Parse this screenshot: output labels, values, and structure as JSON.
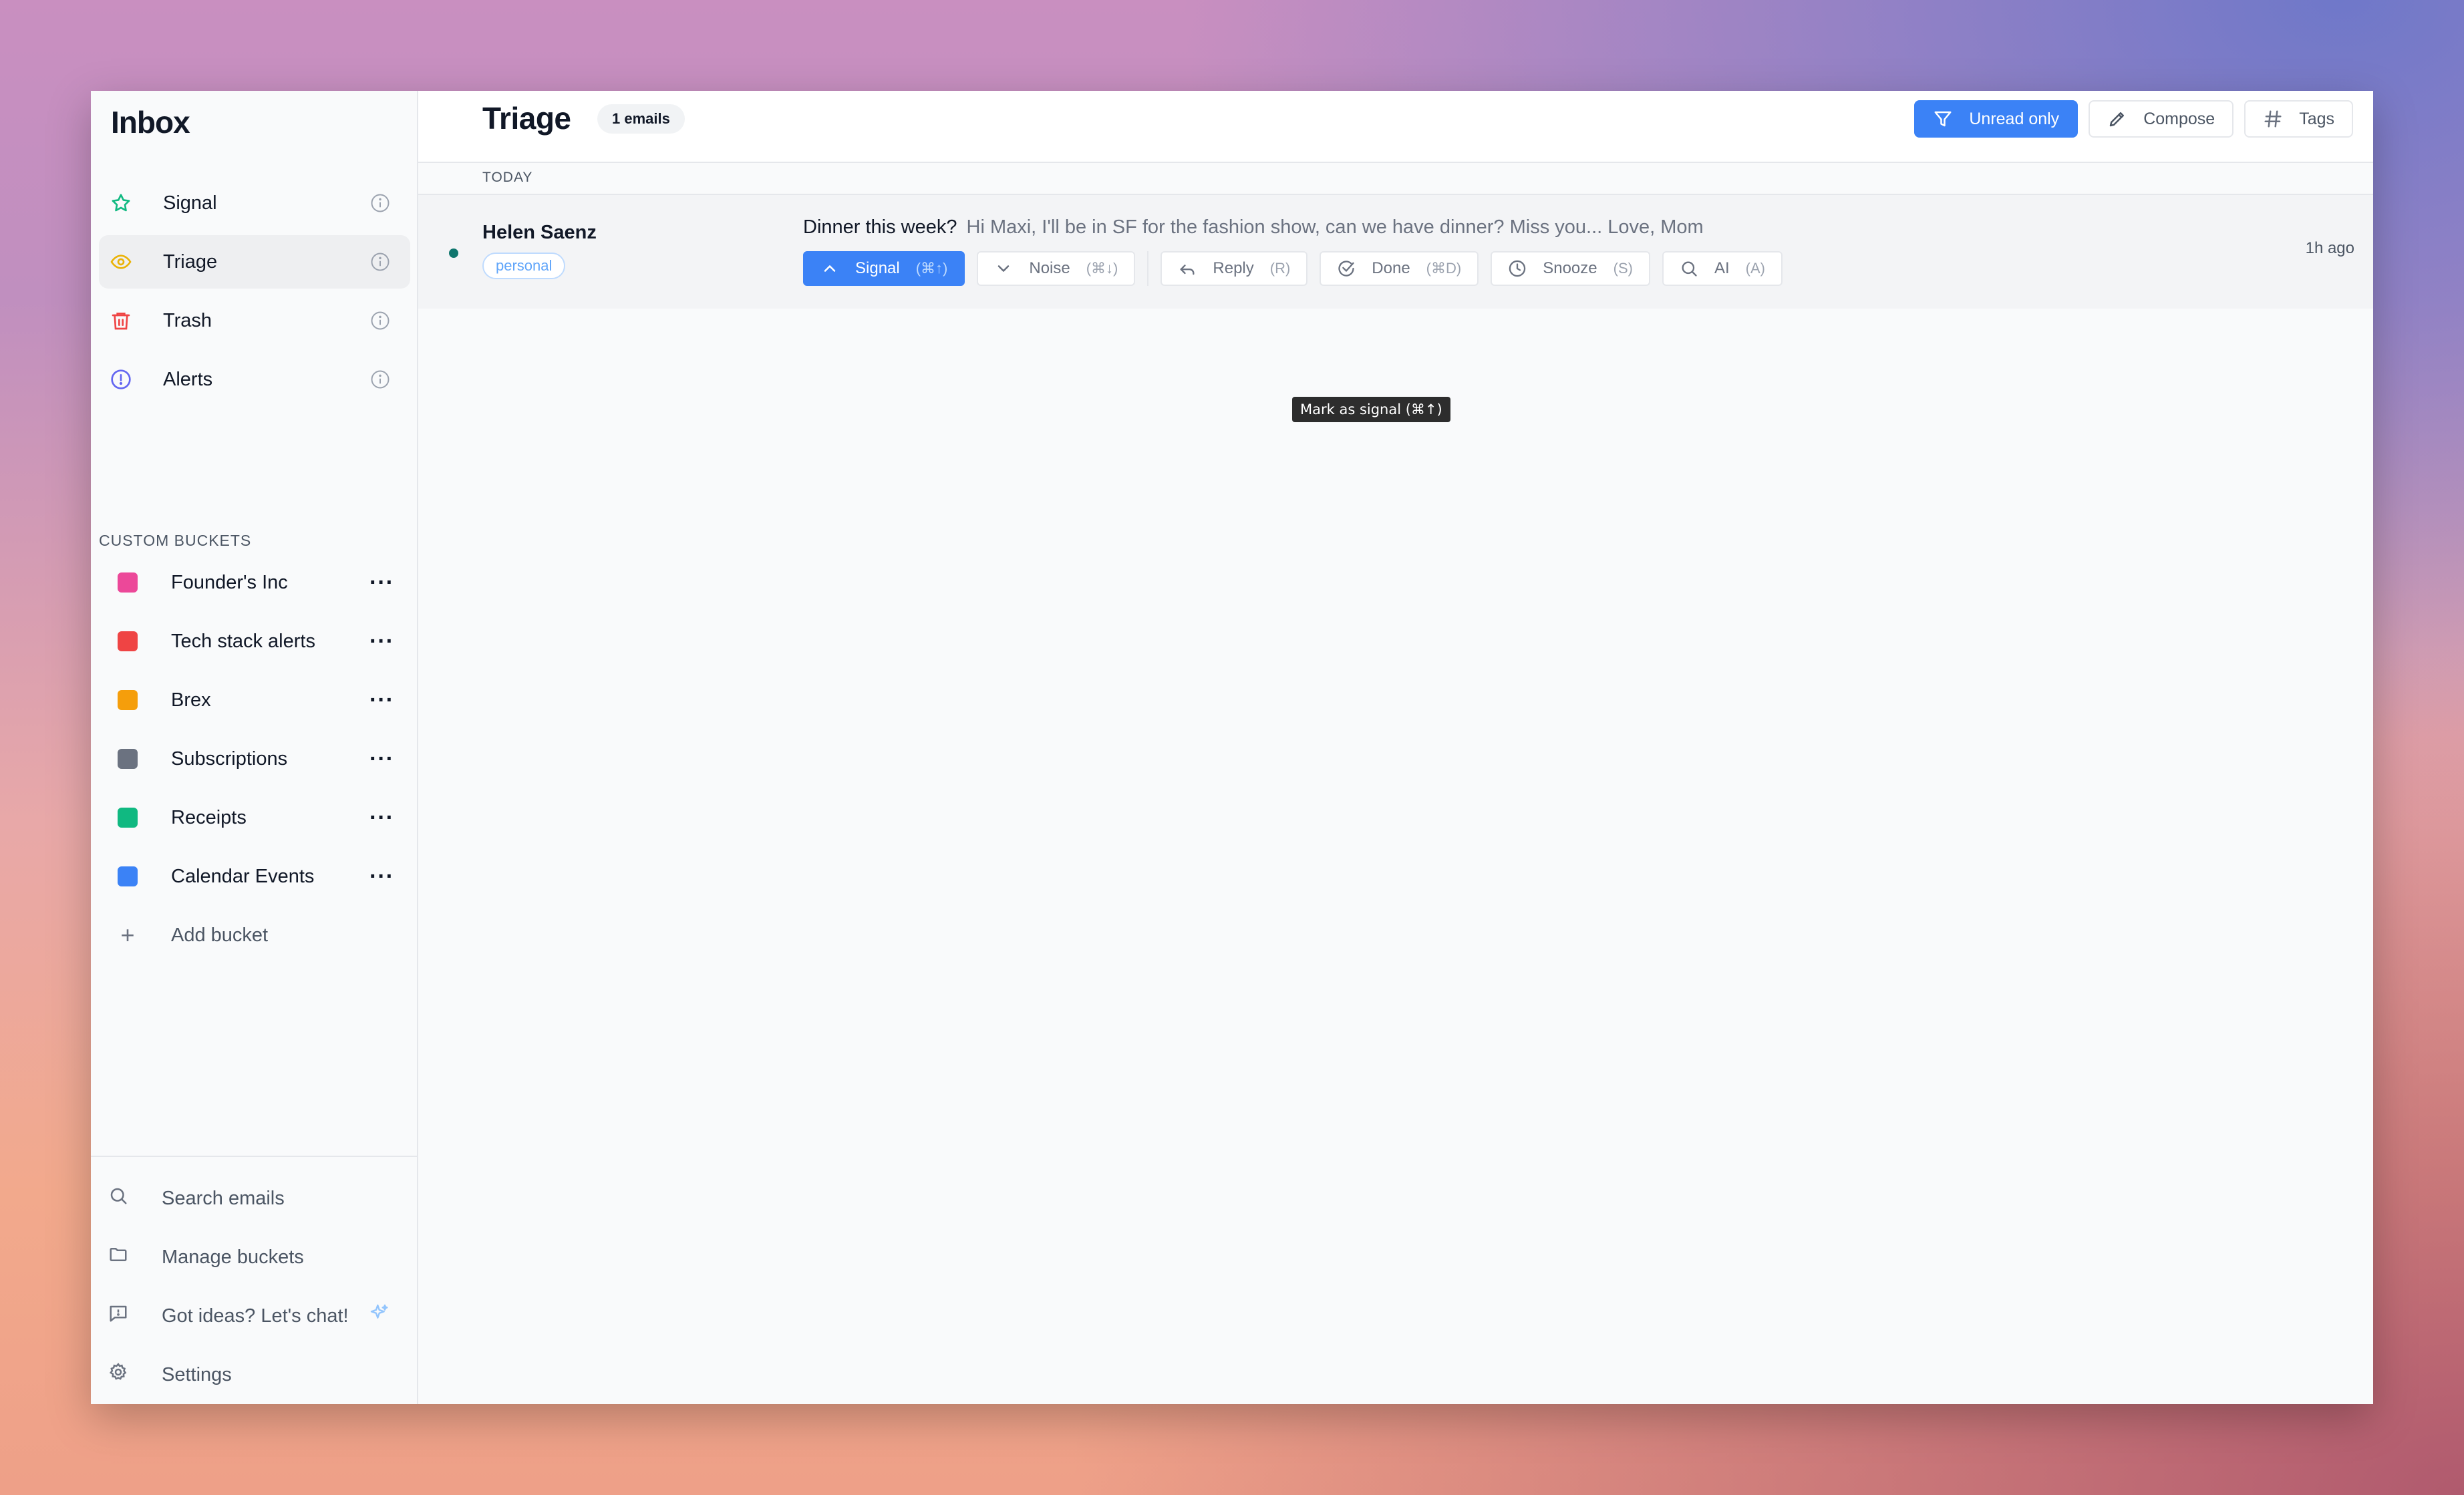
{
  "sidebar": {
    "title": "Inbox",
    "nav": [
      {
        "label": "Signal",
        "icon": "star-icon",
        "active": false
      },
      {
        "label": "Triage",
        "icon": "eye-icon",
        "active": true
      },
      {
        "label": "Trash",
        "icon": "trash-icon",
        "active": false
      },
      {
        "label": "Alerts",
        "icon": "alert-circle-icon",
        "active": false
      }
    ],
    "custom_buckets_label": "CUSTOM BUCKETS",
    "buckets": [
      {
        "label": "Founder's Inc",
        "color": "#ec4899"
      },
      {
        "label": "Tech stack alerts",
        "color": "#ef4444"
      },
      {
        "label": "Brex",
        "color": "#f59e0b"
      },
      {
        "label": "Subscriptions",
        "color": "#6b7280"
      },
      {
        "label": "Receipts",
        "color": "#10b981"
      },
      {
        "label": "Calendar Events",
        "color": "#3b82f6"
      }
    ],
    "add_bucket_label": "Add bucket",
    "footer": [
      {
        "label": "Search emails",
        "icon": "search-icon"
      },
      {
        "label": "Manage buckets",
        "icon": "folder-icon"
      },
      {
        "label": "Got ideas? Let's chat!",
        "icon": "message-icon"
      },
      {
        "label": "Settings",
        "icon": "gear-icon"
      }
    ]
  },
  "header": {
    "title": "Triage",
    "count_badge": "1 emails",
    "unread_only_label": "Unread only",
    "compose_label": "Compose",
    "tags_label": "Tags"
  },
  "list": {
    "group_label": "TODAY",
    "emails": [
      {
        "sender": "Helen Saenz",
        "tag": "personal",
        "subject": "Dinner this week?",
        "preview": "Hi Maxi, I'll be in SF for the fashion show, can we have dinner? Miss you... Love, Mom",
        "time": "1h ago",
        "unread": true
      }
    ],
    "actions": [
      {
        "label": "Signal",
        "shortcut": "(⌘↑)",
        "icon": "chevron-up-icon"
      },
      {
        "label": "Noise",
        "shortcut": "(⌘↓)",
        "icon": "chevron-down-icon"
      },
      {
        "label": "Reply",
        "shortcut": "(R)",
        "icon": "reply-icon"
      },
      {
        "label": "Done",
        "shortcut": "(⌘D)",
        "icon": "check-circle-icon"
      },
      {
        "label": "Snooze",
        "shortcut": "(S)",
        "icon": "clock-icon"
      },
      {
        "label": "AI",
        "shortcut": "(A)",
        "icon": "search-icon"
      }
    ]
  },
  "tooltip": "Mark as signal (⌘↑)",
  "colors": {
    "accent": "#3b82f6",
    "unread_dot": "#0f766e"
  }
}
